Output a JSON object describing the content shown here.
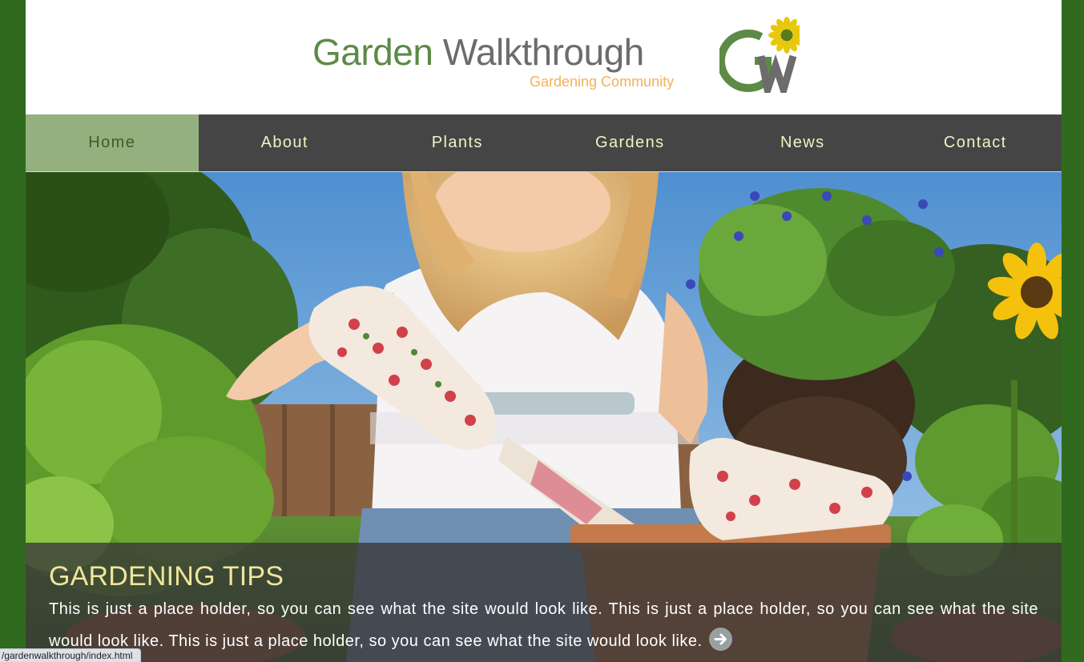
{
  "header": {
    "brand_word_1": "Garden",
    "brand_word_2": "Walkthrough",
    "tagline": "Gardening Community",
    "logo_letters": "GW",
    "colors": {
      "brand_green": "#5d8a46",
      "brand_grey": "#6c6c6c",
      "tagline_orange": "#f2b15b"
    }
  },
  "nav": {
    "items": [
      {
        "label": "Home",
        "active": true
      },
      {
        "label": "About",
        "active": false
      },
      {
        "label": "Plants",
        "active": false
      },
      {
        "label": "Gardens",
        "active": false
      },
      {
        "label": "News",
        "active": false
      },
      {
        "label": "Contact",
        "active": false
      }
    ],
    "colors": {
      "bar": "#454545",
      "active_bg": "#94b07e",
      "text": "#f3f1c4"
    }
  },
  "hero": {
    "image": "woman-gardening-photo",
    "title": "GARDENING TIPS",
    "text": "This is just a place holder, so you can see what the site would look like. This is just a place holder, so you can see what the site would look like. This is just a place holder, so you can see what the site would look like.",
    "read_more_icon": "arrow-right-circle-icon"
  },
  "status_bar": {
    "url": "/gardenwalkthrough/index.html"
  },
  "colors": {
    "page_background": "#306a1e"
  }
}
